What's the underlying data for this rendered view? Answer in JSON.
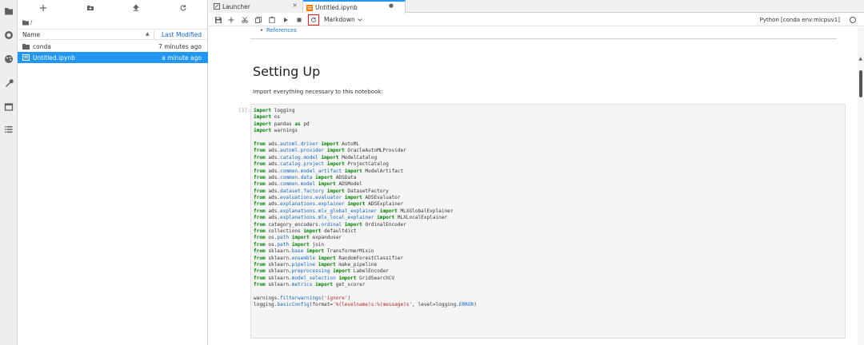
{
  "activity_bar": {
    "items": [
      {
        "icon": "folder-icon"
      },
      {
        "icon": "running-icon"
      },
      {
        "icon": "palette-icon"
      },
      {
        "icon": "wrench-icon"
      },
      {
        "icon": "window-icon"
      },
      {
        "icon": "list-icon"
      }
    ]
  },
  "file_browser": {
    "breadcrumb": "/",
    "header": {
      "name": "Name",
      "last_modified": "Last Modified"
    },
    "files": [
      {
        "name": "conda",
        "modified": "7 minutes ago",
        "icon": "folder-icon",
        "selected": false
      },
      {
        "name": "Untitled.ipynb",
        "modified": "a minute ago",
        "icon": "notebook-icon",
        "selected": true
      }
    ]
  },
  "tabs": [
    {
      "label": "Launcher",
      "close": "×",
      "active": false
    },
    {
      "label": "Untitled.ipynb",
      "close": "●",
      "active": true
    }
  ],
  "notebook_toolbar": {
    "cell_type": "Markdown",
    "kernel": "Python [conda env:mlcpuv1]"
  },
  "notebook": {
    "references_link": "References",
    "heading": "Setting Up",
    "paragraph": "Import everything necessary to this notebook:",
    "prompt": "[1]:",
    "code_lines": [
      [
        [
          "kw",
          "import"
        ],
        [
          "t",
          " logging"
        ]
      ],
      [
        [
          "kw",
          "import"
        ],
        [
          "t",
          " os"
        ]
      ],
      [
        [
          "kw",
          "import"
        ],
        [
          "t",
          " pandas "
        ],
        [
          "kw",
          "as"
        ],
        [
          "t",
          " pd"
        ]
      ],
      [
        [
          "kw",
          "import"
        ],
        [
          "t",
          " warnings"
        ]
      ],
      [
        [
          "t",
          ""
        ]
      ],
      [
        [
          "kw",
          "from"
        ],
        [
          "t",
          " ads."
        ],
        [
          "mod",
          "automl.driver"
        ],
        [
          "t",
          " "
        ],
        [
          "kw",
          "import"
        ],
        [
          "t",
          " AutoML"
        ]
      ],
      [
        [
          "kw",
          "from"
        ],
        [
          "t",
          " ads."
        ],
        [
          "mod",
          "automl.provider"
        ],
        [
          "t",
          " "
        ],
        [
          "kw",
          "import"
        ],
        [
          "t",
          " OracleAutoMLProvider"
        ]
      ],
      [
        [
          "kw",
          "from"
        ],
        [
          "t",
          " ads."
        ],
        [
          "mod",
          "catalog.model"
        ],
        [
          "t",
          " "
        ],
        [
          "kw",
          "import"
        ],
        [
          "t",
          " ModelCatalog"
        ]
      ],
      [
        [
          "kw",
          "from"
        ],
        [
          "t",
          " ads."
        ],
        [
          "mod",
          "catalog.project"
        ],
        [
          "t",
          " "
        ],
        [
          "kw",
          "import"
        ],
        [
          "t",
          " ProjectCatalog"
        ]
      ],
      [
        [
          "kw",
          "from"
        ],
        [
          "t",
          " ads."
        ],
        [
          "mod",
          "common.model_artifact"
        ],
        [
          "t",
          " "
        ],
        [
          "kw",
          "import"
        ],
        [
          "t",
          " ModelArtifact"
        ]
      ],
      [
        [
          "kw",
          "from"
        ],
        [
          "t",
          " ads."
        ],
        [
          "mod",
          "common.data"
        ],
        [
          "t",
          " "
        ],
        [
          "kw",
          "import"
        ],
        [
          "t",
          " ADSData"
        ]
      ],
      [
        [
          "kw",
          "from"
        ],
        [
          "t",
          " ads."
        ],
        [
          "mod",
          "common.model"
        ],
        [
          "t",
          " "
        ],
        [
          "kw",
          "import"
        ],
        [
          "t",
          " ADSModel"
        ]
      ],
      [
        [
          "kw",
          "from"
        ],
        [
          "t",
          " ads."
        ],
        [
          "mod",
          "dataset.factory"
        ],
        [
          "t",
          " "
        ],
        [
          "kw",
          "import"
        ],
        [
          "t",
          " DatasetFactory"
        ]
      ],
      [
        [
          "kw",
          "from"
        ],
        [
          "t",
          " ads."
        ],
        [
          "mod",
          "evaluations.evaluator"
        ],
        [
          "t",
          " "
        ],
        [
          "kw",
          "import"
        ],
        [
          "t",
          " ADSEvaluator"
        ]
      ],
      [
        [
          "kw",
          "from"
        ],
        [
          "t",
          " ads."
        ],
        [
          "mod",
          "explanations.explainer"
        ],
        [
          "t",
          " "
        ],
        [
          "kw",
          "import"
        ],
        [
          "t",
          " ADSExplainer"
        ]
      ],
      [
        [
          "kw",
          "from"
        ],
        [
          "t",
          " ads."
        ],
        [
          "mod",
          "explanations.mlx_global_explainer"
        ],
        [
          "t",
          " "
        ],
        [
          "kw",
          "import"
        ],
        [
          "t",
          " MLXGlobalExplainer"
        ]
      ],
      [
        [
          "kw",
          "from"
        ],
        [
          "t",
          " ads."
        ],
        [
          "mod",
          "explanations.mlx_local_explainer"
        ],
        [
          "t",
          " "
        ],
        [
          "kw",
          "import"
        ],
        [
          "t",
          " MLXLocalExplainer"
        ]
      ],
      [
        [
          "kw",
          "from"
        ],
        [
          "t",
          " category_encoders."
        ],
        [
          "mod",
          "ordinal"
        ],
        [
          "t",
          " "
        ],
        [
          "kw",
          "import"
        ],
        [
          "t",
          " OrdinalEncoder"
        ]
      ],
      [
        [
          "kw",
          "from"
        ],
        [
          "t",
          " collections "
        ],
        [
          "kw",
          "import"
        ],
        [
          "t",
          " defaultdict"
        ]
      ],
      [
        [
          "kw",
          "from"
        ],
        [
          "t",
          " os."
        ],
        [
          "mod",
          "path"
        ],
        [
          "t",
          " "
        ],
        [
          "kw",
          "import"
        ],
        [
          "t",
          " expanduser"
        ]
      ],
      [
        [
          "kw",
          "from"
        ],
        [
          "t",
          " os."
        ],
        [
          "mod",
          "path"
        ],
        [
          "t",
          " "
        ],
        [
          "kw",
          "import"
        ],
        [
          "t",
          " join"
        ]
      ],
      [
        [
          "kw",
          "from"
        ],
        [
          "t",
          " sklearn."
        ],
        [
          "mod",
          "base"
        ],
        [
          "t",
          " "
        ],
        [
          "kw",
          "import"
        ],
        [
          "t",
          " TransformerMixin"
        ]
      ],
      [
        [
          "kw",
          "from"
        ],
        [
          "t",
          " sklearn."
        ],
        [
          "mod",
          "ensemble"
        ],
        [
          "t",
          " "
        ],
        [
          "kw",
          "import"
        ],
        [
          "t",
          " RandomForestClassifier"
        ]
      ],
      [
        [
          "kw",
          "from"
        ],
        [
          "t",
          " sklearn."
        ],
        [
          "mod",
          "pipeline"
        ],
        [
          "t",
          " "
        ],
        [
          "kw",
          "import"
        ],
        [
          "t",
          " make_pipeline"
        ]
      ],
      [
        [
          "kw",
          "from"
        ],
        [
          "t",
          " sklearn."
        ],
        [
          "mod",
          "preprocessing"
        ],
        [
          "t",
          " "
        ],
        [
          "kw",
          "import"
        ],
        [
          "t",
          " LabelEncoder"
        ]
      ],
      [
        [
          "kw",
          "from"
        ],
        [
          "t",
          " sklearn."
        ],
        [
          "mod",
          "model_selection"
        ],
        [
          "t",
          " "
        ],
        [
          "kw",
          "import"
        ],
        [
          "t",
          " GridSearchCV"
        ]
      ],
      [
        [
          "kw",
          "from"
        ],
        [
          "t",
          " sklearn."
        ],
        [
          "mod",
          "metrics"
        ],
        [
          "t",
          " "
        ],
        [
          "kw",
          "import"
        ],
        [
          "t",
          " get_scorer"
        ]
      ],
      [
        [
          "t",
          ""
        ]
      ],
      [
        [
          "t",
          "warnings."
        ],
        [
          "mod",
          "filterwarnings"
        ],
        [
          "t",
          "("
        ],
        [
          "str",
          "'ignore'"
        ],
        [
          "t",
          ")"
        ]
      ],
      [
        [
          "t",
          "logging."
        ],
        [
          "mod",
          "basicConfig"
        ],
        [
          "t",
          "(format="
        ],
        [
          "str",
          "'%(levelname)s:%(message)s'"
        ],
        [
          "t",
          ", level=logging."
        ],
        [
          "mod",
          "ERROR"
        ],
        [
          "t",
          ")"
        ]
      ]
    ]
  },
  "colors": {
    "accent": "#2196f3",
    "highlight": "#e02020",
    "keyword": "#008000",
    "module": "#1565c0",
    "string": "#ba2121"
  }
}
